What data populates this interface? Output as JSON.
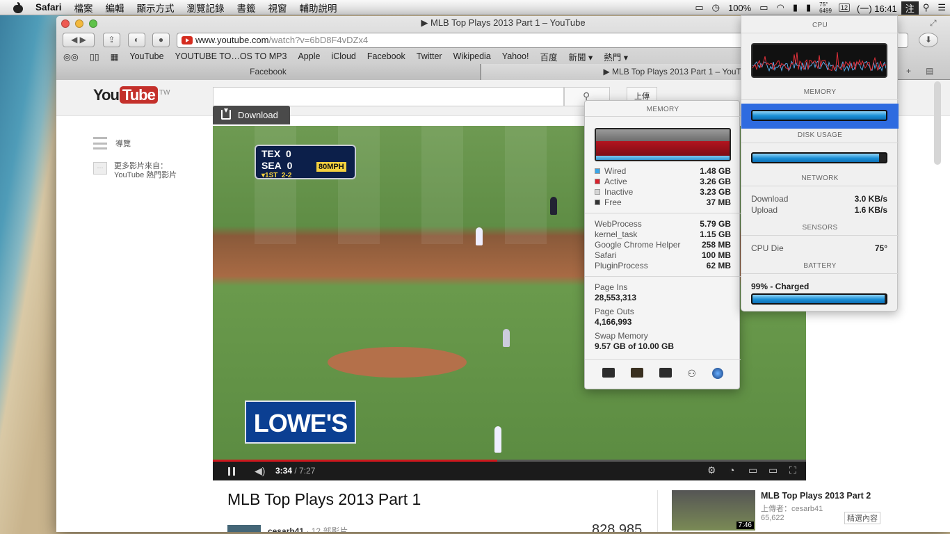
{
  "menubar": {
    "app_name": "Safari",
    "items": [
      "檔案",
      "編輯",
      "顯示方式",
      "瀏覽記錄",
      "書籤",
      "視窗",
      "輔助說明"
    ],
    "status": {
      "battery_pct": "100%",
      "temp": "75°",
      "fan": "6499",
      "calendar_day": "12",
      "clock": "(一) 16:41",
      "input_method": "注"
    }
  },
  "window": {
    "title": "▶ MLB Top Plays 2013 Part 1 – YouTube",
    "url_host": "www.youtube.com",
    "url_rest": "/watch?v=6bD8F4vDZx4",
    "bookmarks": [
      "YouTube",
      "YOUTUBE TO…OS TO MP3",
      "Apple",
      "iCloud",
      "Facebook",
      "Twitter",
      "Wikipedia",
      "Yahoo!",
      "百度",
      "新聞 ▾",
      "熱門 ▾"
    ],
    "tabs": [
      "Facebook",
      "▶ MLB Top Plays 2013 Part 1 – YouTube"
    ]
  },
  "youtube": {
    "logo_you": "You",
    "logo_tube": "Tube",
    "logo_region": "TW",
    "upload": "上傳",
    "nav_guide": "導覽",
    "more_from_1": "更多影片來自：",
    "more_from_2": "YouTube 熱門影片",
    "download_label": "Download",
    "scorebug": {
      "team1": "TEX",
      "score1": "0",
      "team2": "SEA",
      "score2": "0",
      "pitch": "80MPH",
      "inning": "▾1ST",
      "count": "2-2"
    },
    "ad_text": "LOWE'S",
    "time_current": "3:34",
    "time_total": " / 7:27",
    "progress": 0.48,
    "video_title": "MLB Top Plays 2013 Part 1",
    "channel": "cesarb41",
    "channel_videos": "· 12 部影片",
    "views": "828,985",
    "related": {
      "title": "MLB Top Plays 2013 Part 2",
      "uploader": "上傳者：cesarb41",
      "views": "65,622",
      "tag": "精選內容",
      "duration": "7:46"
    }
  },
  "memory_popup": {
    "header": "MEMORY",
    "legend": [
      {
        "label": "Wired",
        "value": "1.48 GB",
        "color": "#3aa6e8"
      },
      {
        "label": "Active",
        "value": "3.26 GB",
        "color": "#d9212c"
      },
      {
        "label": "Inactive",
        "value": "3.23 GB",
        "color": "#d5d5d5"
      },
      {
        "label": "Free",
        "value": "37 MB",
        "color": "#333333"
      }
    ],
    "processes": [
      {
        "label": "WebProcess",
        "value": "5.79 GB"
      },
      {
        "label": "kernel_task",
        "value": "1.15 GB"
      },
      {
        "label": "Google Chrome Helper",
        "value": "258 MB"
      },
      {
        "label": "Safari",
        "value": "100 MB"
      },
      {
        "label": "PluginProcess",
        "value": "62 MB"
      }
    ],
    "page_ins_label": "Page Ins",
    "page_ins": "28,553,313",
    "page_outs_label": "Page Outs",
    "page_outs": "4,166,993",
    "swap_label": "Swap Memory",
    "swap": "9.57 GB of 10.00 GB",
    "icons": [
      "activity-monitor-icon",
      "console-icon",
      "terminal-icon",
      "system-info-icon",
      "network-utility-icon"
    ]
  },
  "istat_panel": {
    "cpu_header": "CPU",
    "memory_header": "MEMORY",
    "memory_used": 1.0,
    "disk_header": "DISK USAGE",
    "disk_used": 0.95,
    "network_header": "NETWORK",
    "download_label": "Download",
    "download": "3.0 KB/s",
    "upload_label": "Upload",
    "upload": "1.6 KB/s",
    "sensors_header": "SENSORS",
    "cpu_die_label": "CPU Die",
    "cpu_die": "75°",
    "battery_header": "BATTERY",
    "battery_status": "99% - Charged",
    "battery_level": 0.99
  }
}
